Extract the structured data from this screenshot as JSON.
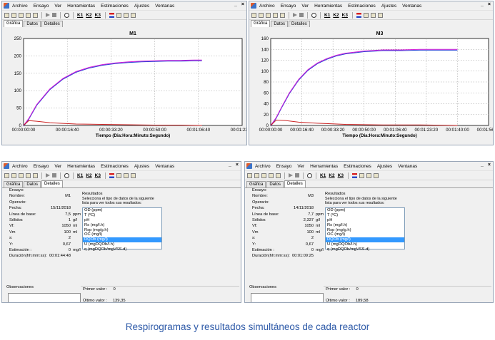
{
  "caption": "Respirogramas y resultados simultáneos de cada reactor",
  "menu": [
    "Archivo",
    "Ensayo",
    "Ver",
    "Herramientas",
    "Estimaciones",
    "Ajustes",
    "Ventanas"
  ],
  "window_controls": [
    "_",
    "×"
  ],
  "toolbar": {
    "k1": "K1",
    "k2": "K2",
    "k3": "K3"
  },
  "tabs": [
    "Gráfica",
    "Datos",
    "Detalles"
  ],
  "colors": {
    "curve_magenta": "#d21cd8",
    "curve_blue": "#3146d8",
    "curve_red": "#cc2222",
    "selection": "#3399ff",
    "caption": "#2e5aa8"
  },
  "chart_data": [
    {
      "type": "line",
      "title": "M1",
      "xlabel": "Tiempo (Dia:Hora:Minuto:Segundo)",
      "x_ticks": [
        "00:00:00:00",
        "00:00:16:40",
        "00:00:33:20",
        "00:00:50:00",
        "00:01:06:40",
        "00:01:23:20"
      ],
      "xlim": [
        0,
        83.33
      ],
      "ylim": [
        0,
        250
      ],
      "y_ticks": [
        0,
        50,
        100,
        150,
        200,
        250
      ],
      "grid": true,
      "series": [
        {
          "color": "#d21cd8",
          "x": [
            0,
            2,
            5,
            10,
            15,
            20,
            25,
            30,
            35,
            40,
            45,
            50,
            55,
            60,
            65,
            68
          ],
          "y": [
            0,
            20,
            60,
            105,
            135,
            155,
            167,
            175,
            180,
            183,
            185,
            186,
            187,
            187,
            188,
            188
          ]
        },
        {
          "color": "#cc2222",
          "x": [
            0,
            2,
            5,
            10,
            15,
            20,
            30,
            40,
            50,
            60,
            68
          ],
          "y": [
            0,
            14,
            12,
            8,
            6,
            4,
            3,
            2,
            1,
            1,
            0
          ]
        }
      ]
    },
    {
      "type": "line",
      "title": "M3",
      "xlabel": "Tiempo (Dia:Hora:Minuto:Segundo)",
      "x_ticks": [
        "00:00:00:00",
        "00:00:16:40",
        "00:00:33:20",
        "00:00:50:00",
        "00:01:06:40",
        "00:01:23:20",
        "00:01:40:00",
        "00:01:56:40"
      ],
      "xlim": [
        0,
        116.67
      ],
      "ylim": [
        0,
        160
      ],
      "y_ticks": [
        0,
        20,
        40,
        60,
        80,
        100,
        120,
        140,
        160
      ],
      "grid": true,
      "series": [
        {
          "color": "#d21cd8",
          "x": [
            0,
            3,
            6,
            10,
            15,
            20,
            25,
            30,
            35,
            40,
            45,
            50,
            55,
            60,
            70,
            80,
            90,
            100
          ],
          "y": [
            0,
            15,
            35,
            60,
            85,
            103,
            115,
            123,
            129,
            133,
            135,
            137,
            138,
            139,
            139,
            140,
            140,
            140
          ]
        },
        {
          "color": "#cc2222",
          "x": [
            0,
            3,
            8,
            15,
            25,
            40,
            60,
            80,
            100
          ],
          "y": [
            0,
            10,
            9,
            6,
            4,
            2,
            1,
            1,
            0
          ]
        }
      ]
    }
  ],
  "details": [
    {
      "fields": [
        {
          "label": "Ensayo:",
          "value": "",
          "unit": ""
        },
        {
          "label": "Nombre:",
          "value": "M1",
          "unit": ""
        },
        {
          "label": "Operario:",
          "value": "",
          "unit": ""
        },
        {
          "label": "Fecha:",
          "value": "15/11/2018",
          "unit": ""
        },
        {
          "label": "Línea de base:",
          "value": "7,5",
          "unit": "ppm"
        },
        {
          "label": "Sólidos",
          "value": "1",
          "unit": "g/l"
        },
        {
          "label": "Vf:",
          "value": "1050",
          "unit": "ml"
        },
        {
          "label": "Vm",
          "value": "100",
          "unit": "ml"
        },
        {
          "label": "s:",
          "value": "2",
          "unit": ""
        },
        {
          "label": "Y:",
          "value": "0,67",
          "unit": ""
        },
        {
          "label": "Estimación :",
          "value": "0",
          "unit": "mg/l"
        },
        {
          "label": "Duración(hh:mm:ss):",
          "value": "00:01:44:48",
          "unit": ""
        }
      ],
      "observaciones": "Observaciones",
      "resultados_title": "Resultados",
      "resultados_hint": "Selecciona el tipo de datos de la siguiente lista para ver todos sus resultados:",
      "list": [
        "OD (ppm)",
        "T (ºC)",
        "pH",
        "Rs (mg/l.h)",
        "Rsp (mg/g.h)",
        "OC (mg/l)",
        "DQOb (mg/l)",
        "U (mgDQOb/l.h)",
        "q (mgDQOb/mgVSS.d)"
      ],
      "selected_index": 6,
      "primer_label": "Primer valor :",
      "primer_value": "0",
      "ultimo_label": "Último valor :",
      "ultimo_value": "139,35"
    },
    {
      "fields": [
        {
          "label": "Ensayo:",
          "value": "",
          "unit": ""
        },
        {
          "label": "Nombre:",
          "value": "M3",
          "unit": ""
        },
        {
          "label": "Operario:",
          "value": "",
          "unit": ""
        },
        {
          "label": "Fecha:",
          "value": "14/11/2018",
          "unit": ""
        },
        {
          "label": "Línea de base:",
          "value": "7,7",
          "unit": "ppm"
        },
        {
          "label": "Sólidos",
          "value": "2,337",
          "unit": "g/l"
        },
        {
          "label": "Vf:",
          "value": "1050",
          "unit": "ml"
        },
        {
          "label": "Vm",
          "value": "100",
          "unit": "ml"
        },
        {
          "label": "s:",
          "value": "2",
          "unit": ""
        },
        {
          "label": "Y:",
          "value": "0,67",
          "unit": ""
        },
        {
          "label": "Estimación :",
          "value": "0",
          "unit": "mg/l"
        },
        {
          "label": "Duración(hh:mm:ss):",
          "value": "00:01:09:25",
          "unit": ""
        }
      ],
      "observaciones": "Observaciones",
      "resultados_title": "Resultados",
      "resultados_hint": "Selecciona el tipo de datos de la siguiente lista para ver todos sus resultados:",
      "list": [
        "OD (ppm)",
        "T (ºC)",
        "pH",
        "Rs (mg/l.h)",
        "Rsp (mg/g.h)",
        "OC (mg/l)",
        "DQOb (mg/l)",
        "U (mgDQOb/l.h)",
        "q (mgDQOb/mgVSS.d)"
      ],
      "selected_index": 6,
      "primer_label": "Primer valor :",
      "primer_value": "0",
      "ultimo_label": "Último valor :",
      "ultimo_value": "189,58"
    }
  ]
}
